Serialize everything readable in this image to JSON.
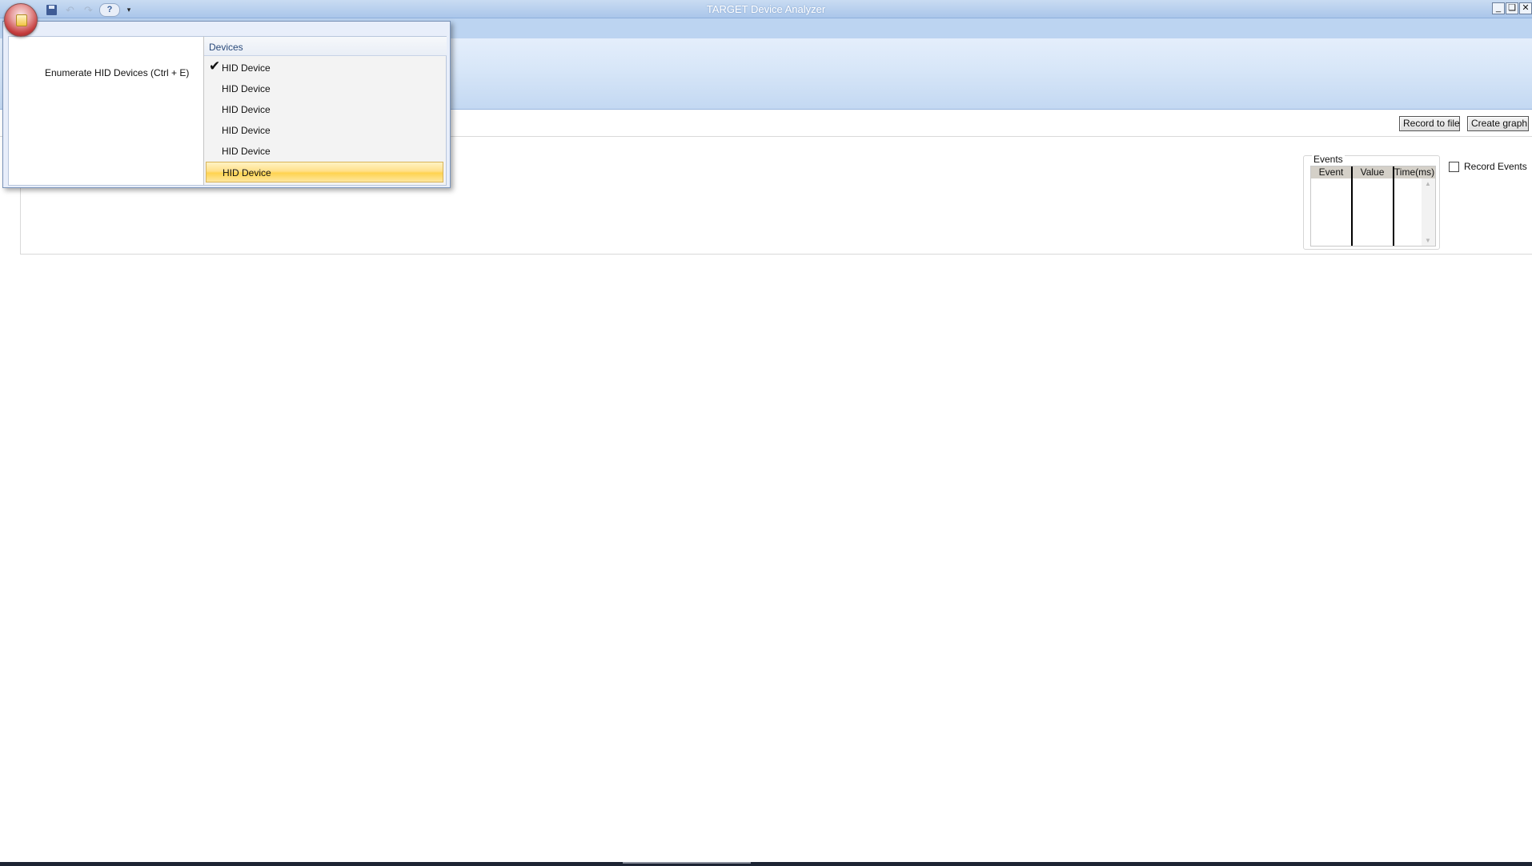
{
  "window": {
    "title": "TARGET Device Analyzer",
    "controls": [
      "_",
      "❏",
      "✕"
    ]
  },
  "quick_access": {
    "save_icon": "save-icon",
    "undo_icon": "undo-icon",
    "redo_icon": "redo-icon",
    "help_label": "?",
    "customize_label": "▾"
  },
  "app_menu": {
    "commands": {
      "enumerate_label": "Enumerate HID Devices (Ctrl + E)"
    },
    "devices": {
      "title": "Devices",
      "items": [
        {
          "label": "HID Device",
          "checked": true,
          "highlighted": false
        },
        {
          "label": "HID Device",
          "checked": false,
          "highlighted": false
        },
        {
          "label": "HID Device",
          "checked": false,
          "highlighted": false
        },
        {
          "label": "HID Device",
          "checked": false,
          "highlighted": false
        },
        {
          "label": "HID Device",
          "checked": false,
          "highlighted": false
        },
        {
          "label": "HID Device",
          "checked": false,
          "highlighted": true
        }
      ],
      "check_glyph": "✔"
    }
  },
  "toolbar": {
    "record_to_file_label": "Record to file",
    "create_graph_label": "Create graph"
  },
  "events": {
    "group_label": "Events",
    "columns": [
      "Event",
      "Value",
      "Time(ms)"
    ],
    "rows": [],
    "record_events_label": "Record Events",
    "record_events_checked": false
  },
  "colors": {
    "title_bar": "#aac6ea",
    "ribbon": "#d7e6f8",
    "highlight": "#ffd350",
    "devices_title": "#2a4a7a"
  }
}
